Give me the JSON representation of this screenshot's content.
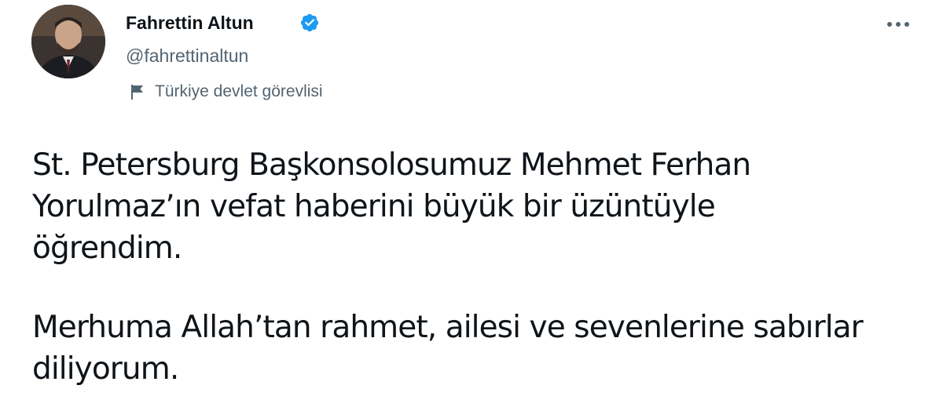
{
  "author": {
    "name": "Fahrettin Altun",
    "handle": "@fahrettinaltun",
    "verified": true,
    "label": "Türkiye devlet görevlisi"
  },
  "icons": {
    "verified": "verified-badge-icon",
    "label": "flag-icon",
    "more": "more-options-icon"
  },
  "colors": {
    "verified_blue": "#1d9bf0",
    "secondary_text": "#536471",
    "primary_text": "#0f1419"
  },
  "tweet": {
    "paragraphs": [
      "St. Petersburg Başkonsolosumuz Mehmet Ferhan\nYorulmaz’ın vefat haberini büyük bir üzüntüyle\nöğrendim.",
      "Merhuma Allah’tan rahmet, ailesi ve sevenlerine sabırlar\ndiliyorum."
    ]
  }
}
